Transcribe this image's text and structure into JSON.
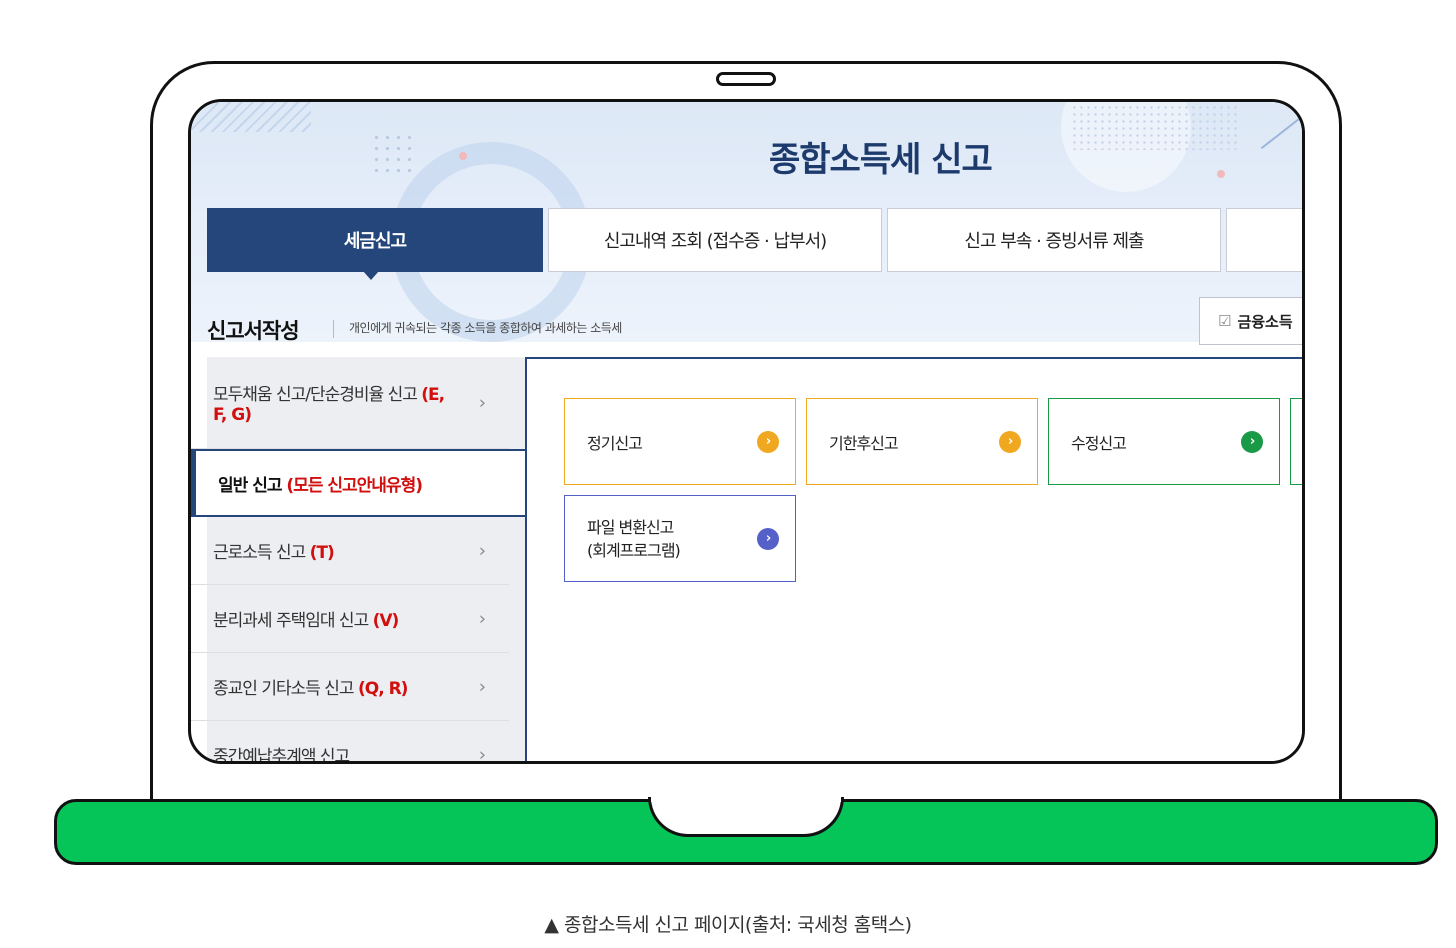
{
  "page_title": "종합소득세 신고",
  "tabs": [
    {
      "label": "세금신고",
      "active": true
    },
    {
      "label": "신고내역 조회 (접수증 · 납부서)",
      "active": false
    },
    {
      "label": "신고 부속 · 증빙서류 제출",
      "active": false
    },
    {
      "label": "",
      "active": false
    }
  ],
  "section": {
    "title": "신고서작성",
    "description": "개인에게 귀속되는 각종 소득을 종합하여 과세하는 소득세",
    "fin_button": "금융소득"
  },
  "side_menu": [
    {
      "label": "모두채움 신고/단순경비율 신고",
      "tag": "(E, F, G)",
      "active": false
    },
    {
      "label": "일반 신고",
      "tag": "(모든 신고안내유형)",
      "active": true
    },
    {
      "label": "근로소득 신고",
      "tag": "(T)",
      "active": false
    },
    {
      "label": "분리과세 주택임대 신고",
      "tag": "(V)",
      "active": false
    },
    {
      "label": "종교인 기타소득 신고",
      "tag": "(Q, R)",
      "active": false
    },
    {
      "label": "중간예납추계액 신고",
      "tag": "",
      "active": false
    }
  ],
  "cards": [
    {
      "label": "정기신고",
      "color": "#f0a820"
    },
    {
      "label": "기한후신고",
      "color": "#f0a820"
    },
    {
      "label": "수정신고",
      "color": "#1a9a46"
    },
    {
      "label": "파일 변환신고",
      "label2": "(회계프로그램)",
      "color": "#5560c8"
    }
  ],
  "colors": {
    "navy": "#24467a",
    "laptop_base": "#05c558",
    "tag_red": "#d10f0f"
  },
  "caption": "▲ 종합소득세 신고 페이지(출처: 국세청 홈택스)"
}
